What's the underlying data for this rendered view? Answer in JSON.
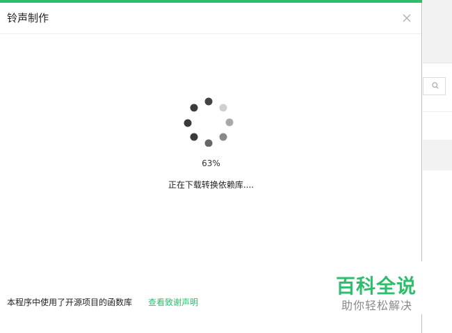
{
  "dialog": {
    "title": "铃声制作",
    "progress": "63%",
    "progress_value": 0.63,
    "status": "正在下载转换依赖库....",
    "footer_note": "本程序中使用了开源项目的函数库",
    "footer_link": "查看致谢声明",
    "close_icon": "close-icon"
  },
  "watermark": {
    "title": "百科全说",
    "subtitle": "助你轻松解决"
  },
  "colors": {
    "accent": "#2dbe6c",
    "spinner_dark": "#444444",
    "spinner_light": "#c8c8c8"
  }
}
